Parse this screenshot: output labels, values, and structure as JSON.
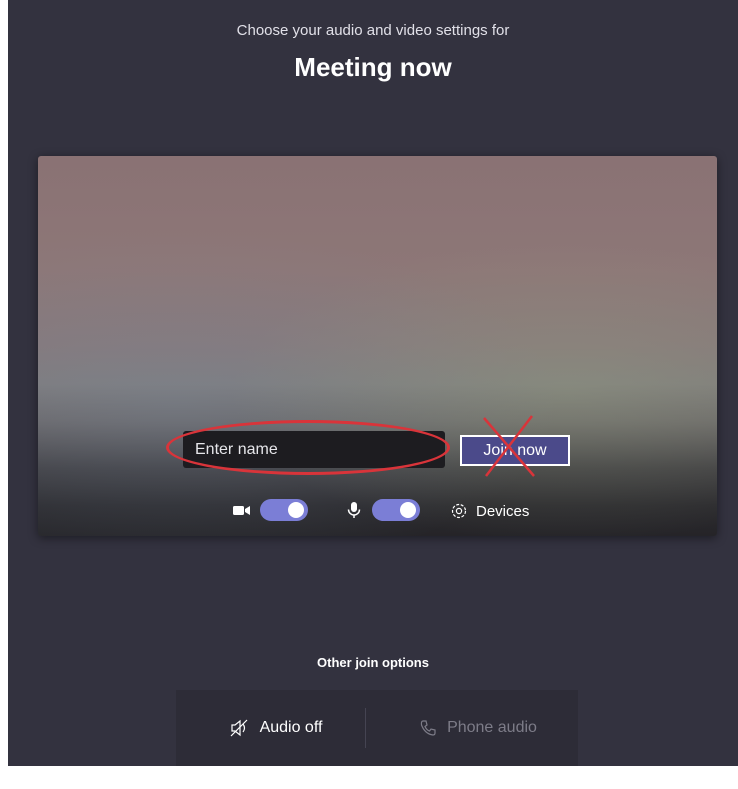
{
  "header": {
    "subtitle": "Choose your audio and video settings for",
    "title": "Meeting now"
  },
  "preview": {
    "name_placeholder": "Enter name",
    "join_label": "Join now",
    "camera": {
      "icon": "camera-icon",
      "on": true
    },
    "microphone": {
      "icon": "microphone-icon",
      "on": true
    },
    "devices_label": "Devices",
    "devices_icon": "gear-icon"
  },
  "annotations": {
    "ellipse_color": "#d9343a",
    "cross_color": "#d9343a"
  },
  "other_options": {
    "label": "Other join options",
    "audio_off_label": "Audio off",
    "audio_off_icon": "speaker-muted-icon",
    "phone_audio_label": "Phone audio",
    "phone_audio_icon": "phone-icon"
  },
  "colors": {
    "background": "#33323f",
    "accent": "#7b7ed6",
    "join_button": "#4b4a8a"
  }
}
